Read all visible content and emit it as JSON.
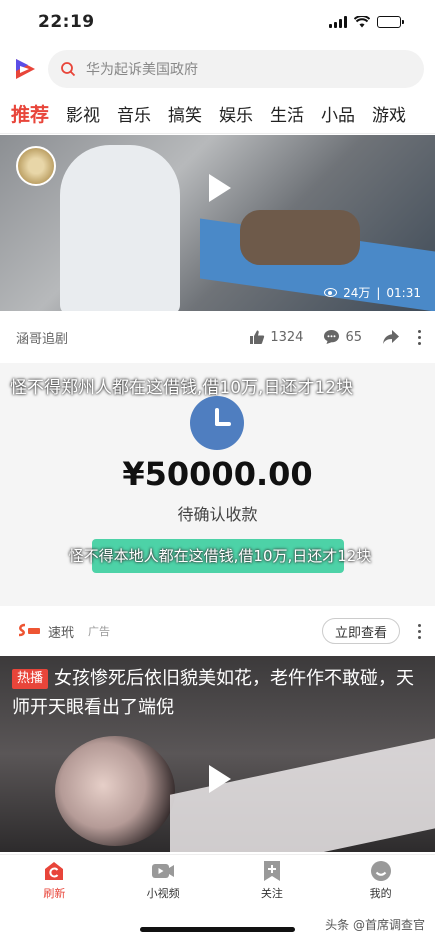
{
  "status_bar": {
    "time": "22:19",
    "battery_level": 0.35
  },
  "search": {
    "placeholder": "华为起诉美国政府"
  },
  "tabs": [
    {
      "label": "推荐",
      "active": true
    },
    {
      "label": "影视"
    },
    {
      "label": "音乐"
    },
    {
      "label": "搞笑"
    },
    {
      "label": "娱乐"
    },
    {
      "label": "生活"
    },
    {
      "label": "小品"
    },
    {
      "label": "游戏"
    }
  ],
  "feed": {
    "video1": {
      "views": "24万",
      "duration": "01:31",
      "author": "涵哥追剧",
      "likes": "1324",
      "comments": "65"
    },
    "ad": {
      "headline": "怪不得郑州人都在这借钱,借10万,日还才12块",
      "amount": "¥50000.00",
      "status_text": "待确认收款",
      "caption": "怪不得本地人都在这借钱,借10万,日还才12块",
      "brand": "速玳",
      "ad_tag": "广告",
      "cta": "立即查看"
    },
    "video2": {
      "badge": "热播",
      "title": "女孩惨死后依旧貌美如花，老仵作不敢碰，天师开天眼看出了端倪"
    }
  },
  "bottom_nav": [
    {
      "label": "刷新",
      "icon": "refresh-home-icon",
      "active": true
    },
    {
      "label": "小视频",
      "icon": "video-camera-icon"
    },
    {
      "label": "关注",
      "icon": "follow-plus-icon"
    },
    {
      "label": "我的",
      "icon": "smiley-profile-icon"
    }
  ],
  "watermark": "头条 @首席调查官",
  "colors": {
    "accent": "#e8453a",
    "ad_button": "#4dd2a7",
    "clock": "#4f7ec0"
  }
}
